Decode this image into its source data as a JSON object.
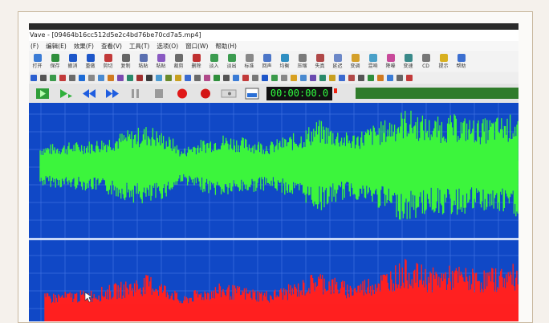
{
  "window": {
    "title": "Vave - [09464b16cc512d5e2c4bd76be70cd7a5.mp4]"
  },
  "menu": [
    "(F)",
    "编辑(E)",
    "效果(F)",
    "查看(V)",
    "工具(T)",
    "选项(O)",
    "窗口(W)",
    "帮助(H)"
  ],
  "toolbar": {
    "buttons": [
      {
        "label": "打开",
        "icon": "folder-icon"
      },
      {
        "label": "保存",
        "icon": "save-icon"
      },
      {
        "label": "撤消",
        "icon": "undo-icon"
      },
      {
        "label": "重做",
        "icon": "redo-icon"
      },
      {
        "label": "剪切",
        "icon": "cut-icon"
      },
      {
        "label": "复制",
        "icon": "copy-icon"
      },
      {
        "label": "粘贴",
        "icon": "paste-icon"
      },
      {
        "label": "粘贴",
        "icon": "paste-mix-icon"
      },
      {
        "label": "裁剪",
        "icon": "trim-icon"
      },
      {
        "label": "删除",
        "icon": "delete-icon"
      },
      {
        "label": "淡入",
        "icon": "fade-in-icon"
      },
      {
        "label": "淡出",
        "icon": "fade-out-icon"
      },
      {
        "label": "标准",
        "icon": "normalize-icon"
      },
      {
        "label": "回声",
        "icon": "echo-icon"
      },
      {
        "label": "均衡",
        "icon": "eq-icon"
      },
      {
        "label": "压缩",
        "icon": "compress-icon"
      },
      {
        "label": "失真",
        "icon": "distort-icon"
      },
      {
        "label": "延迟",
        "icon": "delay-icon"
      },
      {
        "label": "变调",
        "icon": "pitch-icon"
      },
      {
        "label": "混响",
        "icon": "reverb-icon"
      },
      {
        "label": "降噪",
        "icon": "denoise-icon"
      },
      {
        "label": "变速",
        "icon": "speed-icon"
      },
      {
        "label": "CD",
        "icon": "cd-icon"
      },
      {
        "label": "提示",
        "icon": "hint-icon"
      },
      {
        "label": "帮助",
        "icon": "help-icon"
      }
    ]
  },
  "transport": {
    "time": "00:00:00.0",
    "buttons": [
      "play",
      "play-loop",
      "rewind",
      "fast-forward",
      "pause",
      "stop",
      "record",
      "record-alt",
      "punch",
      "view"
    ]
  },
  "waveform": {
    "channels": [
      {
        "name": "left",
        "color": "#3cf53c"
      },
      {
        "name": "right",
        "color": "#ff2020"
      }
    ],
    "background": "#1048c6",
    "grid_color": "#4a7ae8"
  },
  "colors": {
    "time_display_bg": "#111111",
    "time_display_text": "#30ff40",
    "progress_bar": "#2f7c2b"
  }
}
